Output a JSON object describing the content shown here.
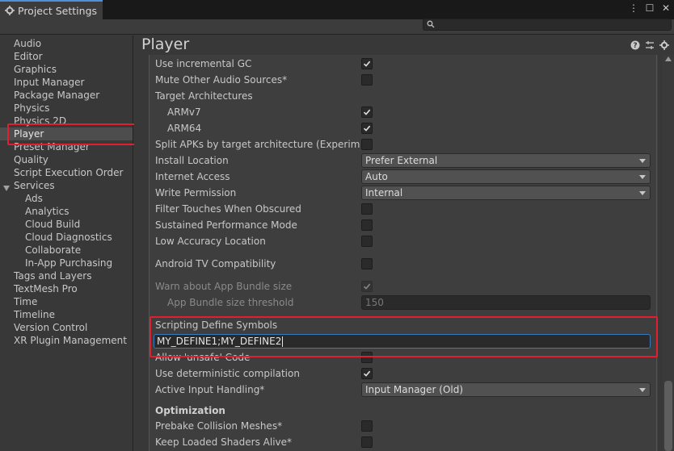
{
  "window": {
    "tab_title": "Project Settings",
    "title_icon": "gear-icon",
    "controls": [
      "more-icon",
      "maximize-icon",
      "close-icon"
    ]
  },
  "search": {
    "placeholder": "",
    "value": ""
  },
  "sidebar": {
    "items": [
      {
        "label": "Audio",
        "level": 0
      },
      {
        "label": "Editor",
        "level": 0
      },
      {
        "label": "Graphics",
        "level": 0
      },
      {
        "label": "Input Manager",
        "level": 0
      },
      {
        "label": "Package Manager",
        "level": 0
      },
      {
        "label": "Physics",
        "level": 0
      },
      {
        "label": "Physics 2D",
        "level": 0
      },
      {
        "label": "Player",
        "level": 0,
        "selected": true
      },
      {
        "label": "Preset Manager",
        "level": 0
      },
      {
        "label": "Quality",
        "level": 0
      },
      {
        "label": "Script Execution Order",
        "level": 0
      },
      {
        "label": "Services",
        "level": 0,
        "expanded": true
      },
      {
        "label": "Ads",
        "level": 1
      },
      {
        "label": "Analytics",
        "level": 1
      },
      {
        "label": "Cloud Build",
        "level": 1
      },
      {
        "label": "Cloud Diagnostics",
        "level": 1
      },
      {
        "label": "Collaborate",
        "level": 1
      },
      {
        "label": "In-App Purchasing",
        "level": 1
      },
      {
        "label": "Tags and Layers",
        "level": 0
      },
      {
        "label": "TextMesh Pro",
        "level": 0
      },
      {
        "label": "Time",
        "level": 0
      },
      {
        "label": "Timeline",
        "level": 0
      },
      {
        "label": "Version Control",
        "level": 0
      },
      {
        "label": "XR Plugin Management",
        "level": 0
      }
    ]
  },
  "header": {
    "title": "Player",
    "icons": [
      "help-icon",
      "presets-icon",
      "settings-icon"
    ]
  },
  "settings": {
    "use_incremental_gc": {
      "label": "Use incremental GC",
      "checked": true
    },
    "mute_other_audio": {
      "label": "Mute Other Audio Sources*",
      "checked": false
    },
    "target_architectures": {
      "label": "Target Architectures"
    },
    "armv7": {
      "label": "ARMv7",
      "checked": true
    },
    "arm64": {
      "label": "ARM64",
      "checked": true
    },
    "split_apks": {
      "label": "Split APKs by target architecture (Experimental)",
      "checked": false
    },
    "install_location": {
      "label": "Install Location",
      "value": "Prefer External"
    },
    "internet_access": {
      "label": "Internet Access",
      "value": "Auto"
    },
    "write_permission": {
      "label": "Write Permission",
      "value": "Internal"
    },
    "filter_touches": {
      "label": "Filter Touches When Obscured",
      "checked": false
    },
    "sustained_performance": {
      "label": "Sustained Performance Mode",
      "checked": false
    },
    "low_accuracy_location": {
      "label": "Low Accuracy Location",
      "checked": false
    },
    "android_tv": {
      "label": "Android TV Compatibility",
      "checked": false
    },
    "warn_bundle_size": {
      "label": "Warn about App Bundle size",
      "checked": true,
      "disabled": true
    },
    "bundle_threshold": {
      "label": "App Bundle size threshold",
      "value": "150",
      "disabled": true
    },
    "scripting_define": {
      "label": "Scripting Define Symbols",
      "value": "MY_DEFINE1;MY_DEFINE2"
    },
    "allow_unsafe": {
      "label": "Allow 'unsafe' Code",
      "checked": false
    },
    "deterministic": {
      "label": "Use deterministic compilation",
      "checked": true
    },
    "active_input": {
      "label": "Active Input Handling*",
      "value": "Input Manager (Old)"
    },
    "optimization": {
      "label": "Optimization"
    },
    "prebake_collision": {
      "label": "Prebake Collision Meshes*",
      "checked": false
    },
    "keep_shaders": {
      "label": "Keep Loaded Shaders Alive*",
      "checked": false
    }
  },
  "colors": {
    "highlight": "#e02030",
    "accent": "#4f8fdc",
    "panel": "#383838"
  }
}
